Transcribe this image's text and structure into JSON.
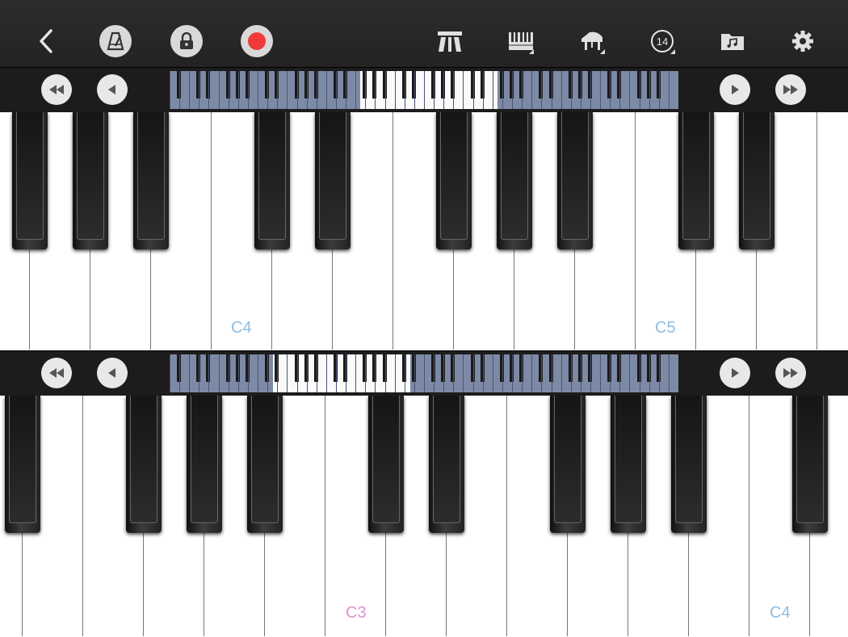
{
  "toolbar": {
    "left": [
      {
        "name": "back-icon",
        "glyph": "‹"
      },
      {
        "name": "metronome-icon",
        "glyph": "⏱"
      },
      {
        "name": "lock-icon",
        "glyph": "🔒"
      },
      {
        "name": "record-icon",
        "glyph": ""
      }
    ],
    "right": [
      {
        "name": "split-keyboard-icon",
        "glyph": "⫪"
      },
      {
        "name": "keyboard-layout-icon",
        "glyph": "▦"
      },
      {
        "name": "instrument-piano-icon",
        "glyph": "♪"
      },
      {
        "name": "key-count-icon",
        "glyph": "14"
      },
      {
        "name": "folder-music-icon",
        "glyph": "♫"
      },
      {
        "name": "settings-icon",
        "glyph": "⚙"
      }
    ],
    "key_count": "14"
  },
  "upper_keyboard": {
    "labels": [
      {
        "text": "C4",
        "color": "#8fbde0"
      },
      {
        "text": "C5",
        "color": "#8fbde0"
      }
    ]
  },
  "lower_keyboard": {
    "labels": [
      {
        "text": "C3",
        "color": "#e28fd0"
      },
      {
        "text": "C4",
        "color": "#8fbde0"
      }
    ]
  },
  "colors": {
    "record": "#f03a3a",
    "label_blue": "#8fbde0",
    "label_pink": "#e28fd0",
    "navigator_bg": "#7d8aa6"
  }
}
